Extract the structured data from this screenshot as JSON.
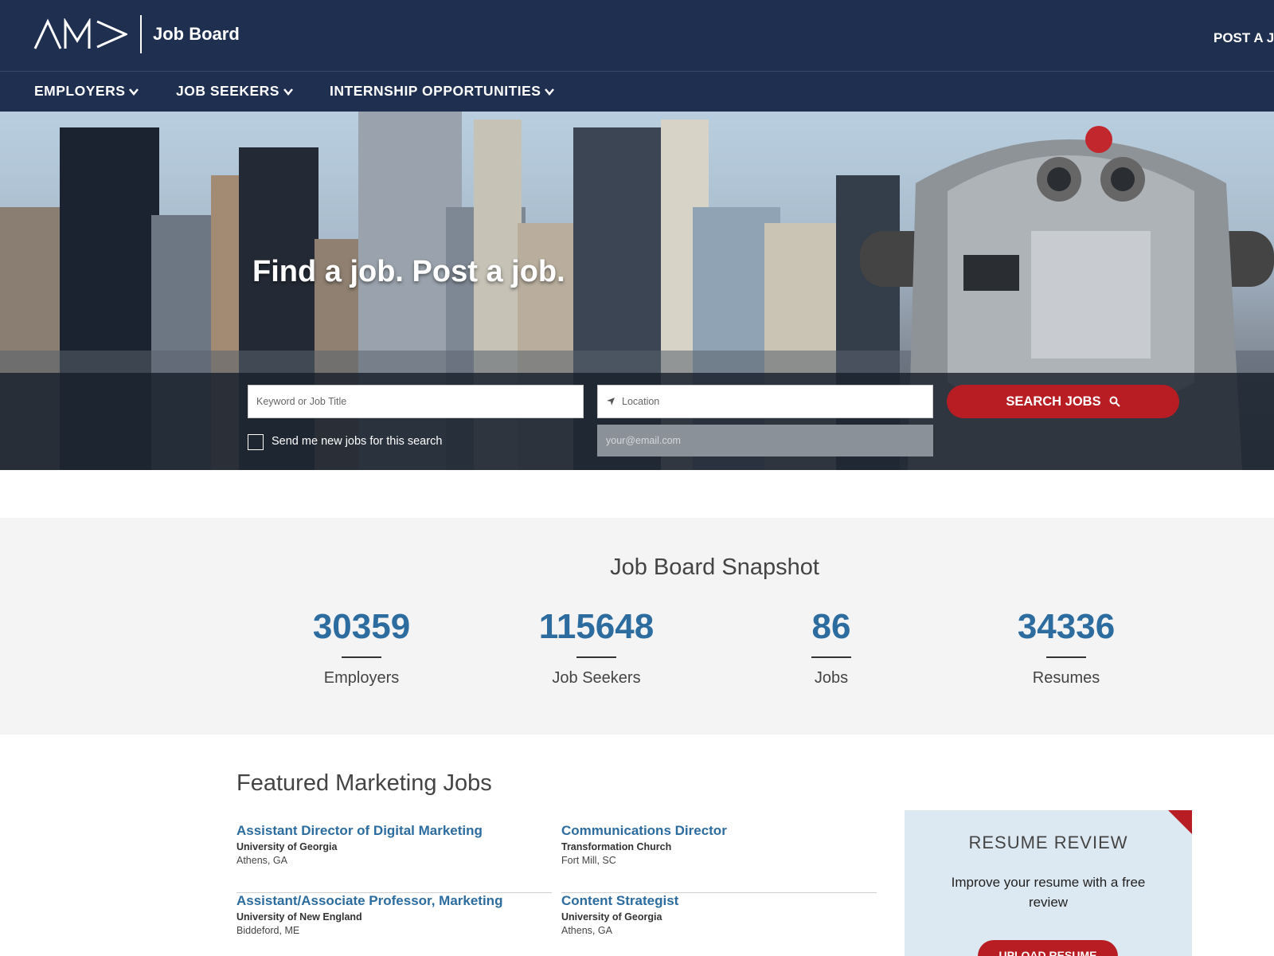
{
  "header": {
    "logo_alt": "AMA",
    "brand_text": "Job Board",
    "post_link": "POST A JOB"
  },
  "nav": {
    "items": [
      {
        "label": "EMPLOYERS"
      },
      {
        "label": "JOB SEEKERS"
      },
      {
        "label": "INTERNSHIP OPPORTUNITIES"
      }
    ]
  },
  "hero": {
    "title": "Find a job. Post a job.",
    "keyword_placeholder": "Keyword or Job Title",
    "location_placeholder": "Location",
    "email_placeholder": "your@email.com",
    "search_button": "SEARCH JOBS",
    "alert_label": "Send me new jobs for this search",
    "alert_checked": false
  },
  "snapshot": {
    "title": "Job Board Snapshot",
    "stats": [
      {
        "value": "30359",
        "label": "Employers"
      },
      {
        "value": "115648",
        "label": "Job Seekers"
      },
      {
        "value": "86",
        "label": "Jobs"
      },
      {
        "value": "34336",
        "label": "Resumes"
      }
    ]
  },
  "featured": {
    "title": "Featured Marketing Jobs",
    "jobs": [
      {
        "title": "Assistant Director of Digital Marketing",
        "company": "University of Georgia",
        "location": "Athens, GA"
      },
      {
        "title": "Communications Director",
        "company": "Transformation Church",
        "location": "Fort Mill, SC"
      },
      {
        "title": "Assistant/Associate Professor, Marketing",
        "company": "University of New England",
        "location": "Biddeford, ME"
      },
      {
        "title": "Content Strategist",
        "company": "University of Georgia",
        "location": "Athens, GA"
      }
    ]
  },
  "resume_review": {
    "title": "RESUME REVIEW",
    "description": "Improve your resume with a free review",
    "button": "UPLOAD RESUME"
  },
  "colors": {
    "navy": "#1f2f4f",
    "accent_red": "#b71d23",
    "stat_blue": "#2c6c9f"
  }
}
